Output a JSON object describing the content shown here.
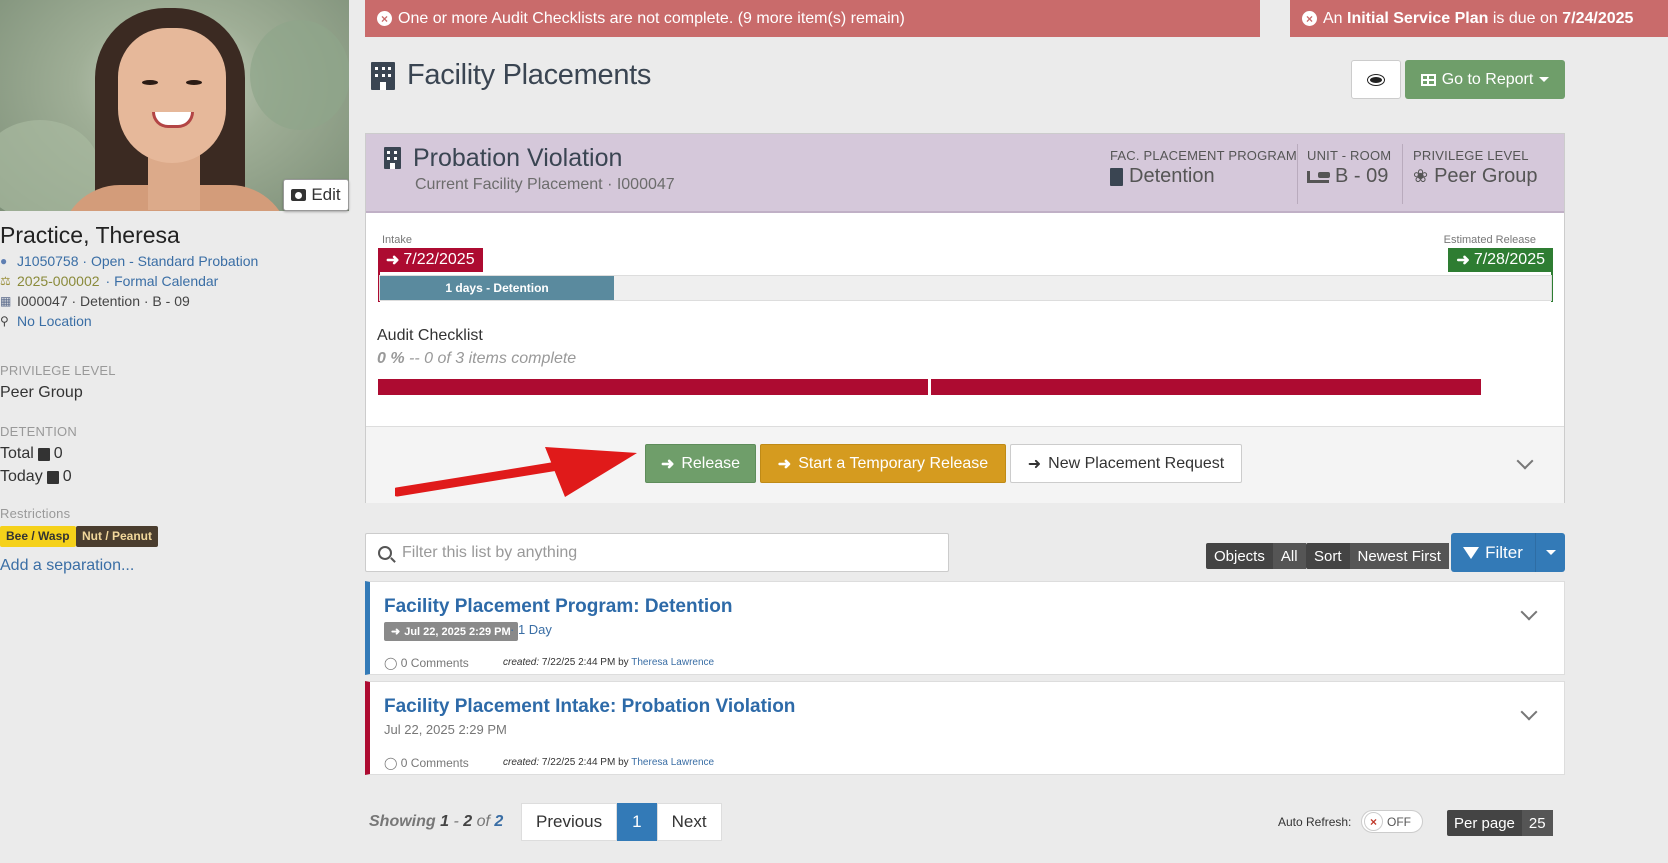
{
  "alerts": {
    "audit": "One or more Audit Checklists are not complete. (9 more item(s) remain)",
    "plan_prefix": "An ",
    "plan_bold": "Initial Service Plan",
    "plan_mid": " is due on ",
    "plan_date": "7/24/2025"
  },
  "profile": {
    "edit_label": "Edit",
    "name": "Practice, Theresa",
    "id_line": "J1050758 · Open - Standard Probation",
    "case_number": "2025-000002",
    "case_calendar": "· Formal Calendar",
    "placement_line": "I000047 · Detention · B - 09",
    "location": "No Location",
    "privilege_label": "PRIVILEGE LEVEL",
    "privilege_value": "Peer Group",
    "detention_label": "DETENTION",
    "total_label": "Total",
    "total_value": "0",
    "today_label": "Today",
    "today_value": "0",
    "restrictions_label": "Restrictions",
    "restrictions": [
      "Bee / Wasp",
      "Nut / Peanut"
    ],
    "add_separation": "Add a separation..."
  },
  "page": {
    "title": "Facility Placements",
    "report_button": "Go to Report"
  },
  "placement": {
    "title": "Probation Violation",
    "subtitle": "Current Facility Placement · I000047",
    "program_label": "FAC. PLACEMENT PROGRAM",
    "program_value": "Detention",
    "unit_label": "UNIT - ROOM",
    "unit_value": "B - 09",
    "privilege_label": "PRIVILEGE LEVEL",
    "privilege_value": "Peer Group",
    "intake_label": "Intake",
    "intake_date": "7/22/2025",
    "release_label": "Estimated Release",
    "release_date": "7/28/2025",
    "duration_text": "1 days - Detention",
    "duration_fraction": 0.2,
    "audit_title": "Audit Checklist",
    "audit_percent": "0 %",
    "audit_detail": " -- 0 of 3 items complete",
    "release_button": "Release",
    "temp_release_button": "Start a Temporary Release",
    "new_request_button": "New Placement Request"
  },
  "list": {
    "filter_placeholder": "Filter this list by anything",
    "objects_label": "Objects",
    "objects_value": "All",
    "sort_label": "Sort",
    "sort_value": "Newest First",
    "filter_button": "Filter",
    "items": [
      {
        "title": "Facility Placement Program: Detention",
        "date": "Jul 22, 2025 2:29 PM",
        "duration": "· 1 Day",
        "comments": "0 Comments",
        "created_label": "created:",
        "created": "7/22/25 2:44 PM by",
        "author": "Theresa Lawrence",
        "accent": "#337ab7"
      },
      {
        "title": "Facility Placement Intake: Probation Violation",
        "date": "Jul 22, 2025 2:29 PM",
        "comments": "0 Comments",
        "created_label": "created:",
        "created": "7/22/25 2:44 PM by",
        "author": "Theresa Lawrence",
        "accent": "#ad0b31"
      }
    ]
  },
  "pagination": {
    "showing_label": "Showing",
    "range_start": "1",
    "range_end": "2",
    "of_label": "of",
    "total": "2",
    "previous": "Previous",
    "current": "1",
    "next": "Next",
    "auto_refresh_label": "Auto Refresh:",
    "auto_refresh_state": "OFF",
    "per_page_label": "Per page",
    "per_page_value": "25"
  },
  "colors": {
    "alert_red": "#c96b6b",
    "success_green": "#6f9e6a",
    "warning_orange": "#d59b1f",
    "primary_blue": "#337ab7",
    "danger_red": "#ad0b31",
    "panel_header": "#d5c8da"
  }
}
